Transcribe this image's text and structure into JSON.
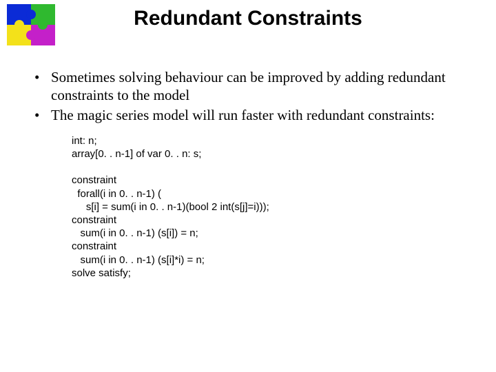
{
  "title": "Redundant Constraints",
  "bullets": [
    "Sometimes solving behaviour can be improved by adding redundant constraints to the model",
    "The magic series model will run faster with redundant constraints:"
  ],
  "code": {
    "l1": "int: n;",
    "l2": "array[0. . n-1] of var 0. . n: s;",
    "l3": "",
    "l4": "constraint",
    "l5": "  forall(i in 0. . n-1) (",
    "l6": "     s[i] = sum(i in 0. . n-1)(bool 2 int(s[j]=i)));",
    "l7": "constraint",
    "l8": "   sum(i in 0. . n-1) (s[i]) = n;",
    "l9": "constraint",
    "l10": "   sum(i in 0. . n-1) (s[i]*i) = n;",
    "l11": "solve satisfy;"
  }
}
